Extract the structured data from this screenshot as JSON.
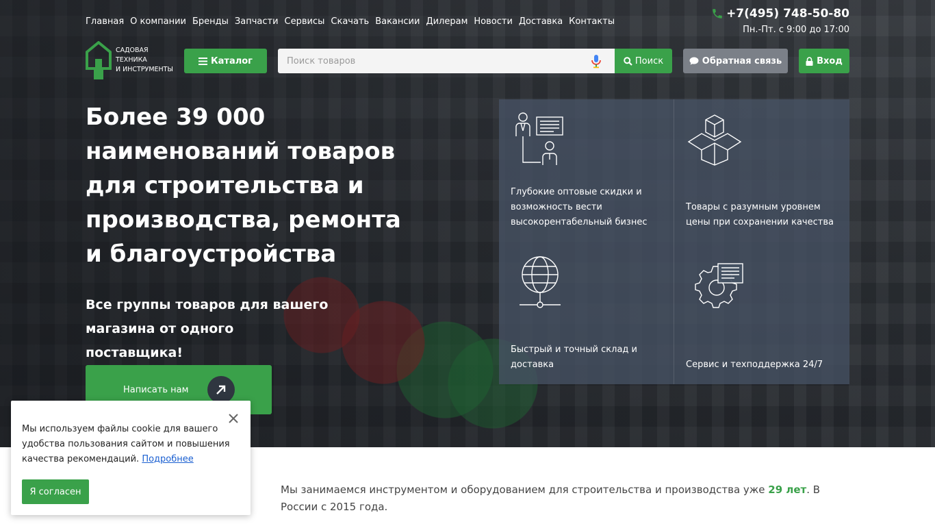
{
  "nav": {
    "items": [
      "Главная",
      "О компании",
      "Бренды",
      "Запчасти",
      "Сервисы",
      "Скачать",
      "Вакансии",
      "Дилерам",
      "Новости",
      "Доставка",
      "Контакты"
    ]
  },
  "contact": {
    "phone": "+7(495) 748-50-80",
    "hours": "Пн.-Пт. с 9:00 до 17:00",
    "icon": "phone-icon"
  },
  "logo": {
    "line1": "Садовая",
    "line2": "техника",
    "line3": "и инструменты"
  },
  "toolbar": {
    "catalog_label": "Каталог",
    "search_placeholder": "Поиск товаров",
    "search_label": "Поиск",
    "feedback_label": "Обратная связь",
    "login_label": "Вход"
  },
  "hero": {
    "title": "Более 39 000 наименований товаров для строительства и производства, ремонта и благоустройства",
    "subtitle": "Все группы товаров для вашего магазина от одного поставщика!",
    "cta_label": "Написать нам"
  },
  "features": [
    {
      "text": "Глубокие оптовые скидки и возможность вести высокорентабельный бизнес",
      "icon": "consultation-icon"
    },
    {
      "text": "Товары с разумным уровнем цены при сохранении качества",
      "icon": "boxes-icon"
    },
    {
      "text": "Быстрый и точный склад и доставка",
      "icon": "globe-network-icon"
    },
    {
      "text": "Сервис и техподдержка 24/7",
      "icon": "gear-support-icon"
    }
  ],
  "about": {
    "text_before": "Мы занимаемся инструментом и оборудованием для строительства и производства уже ",
    "years": "29 лет",
    "text_after": ". В России с 2015 года."
  },
  "cookie": {
    "text": "Мы используем файлы cookie для вашего удобства пользования сайтом и повышения качества рекомендаций.",
    "more_link": "Подробнее",
    "agree_label": "Я согласен"
  },
  "colors": {
    "accent": "#3aa14a",
    "feedback_button": "#7b8088",
    "panel": "#465264"
  }
}
